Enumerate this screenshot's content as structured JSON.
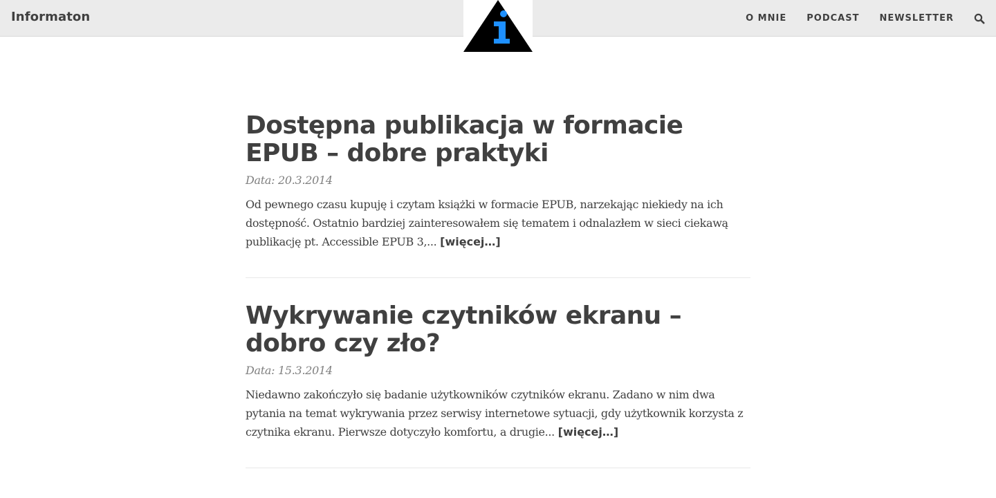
{
  "header": {
    "brand": "Informaton",
    "logo_icon": "info-triangle-icon",
    "nav": [
      {
        "label": "O MNIE"
      },
      {
        "label": "PODCAST"
      },
      {
        "label": "NEWSLETTER"
      }
    ],
    "search_icon": "search-icon"
  },
  "posts": [
    {
      "title": "Dostępna publikacja w formacie EPUB – dobre praktyki",
      "date": "Data: 20.3.2014",
      "excerpt": "Od pewnego czasu kupuję i czytam książki w formacie EPUB, narzekając niekiedy na ich dostępność. Ostatnio bardziej zainteresowałem się tematem i odnalazłem w sieci ciekawą publikację pt. Accessible EPUB 3,...",
      "more_label": "[więcej…]"
    },
    {
      "title": "Wykrywanie czytników ekranu – dobro czy zło?",
      "date": "Data: 15.3.2014",
      "excerpt": "Niedawno zakończyło się badanie użytkowników czytników ekranu. Zadano w nim dwa pytania na temat wykrywania przez serwisy internetowe sytuacji, gdy użytkownik korzysta z czytnika ekranu. Pierwsze dotyczyło komfortu, a drugie...",
      "more_label": "[więcej…]"
    }
  ],
  "colors": {
    "header_bg": "#ebebeb",
    "text": "#404040",
    "date": "#808080",
    "logo_blue": "#1e90ff",
    "logo_black": "#000000"
  }
}
